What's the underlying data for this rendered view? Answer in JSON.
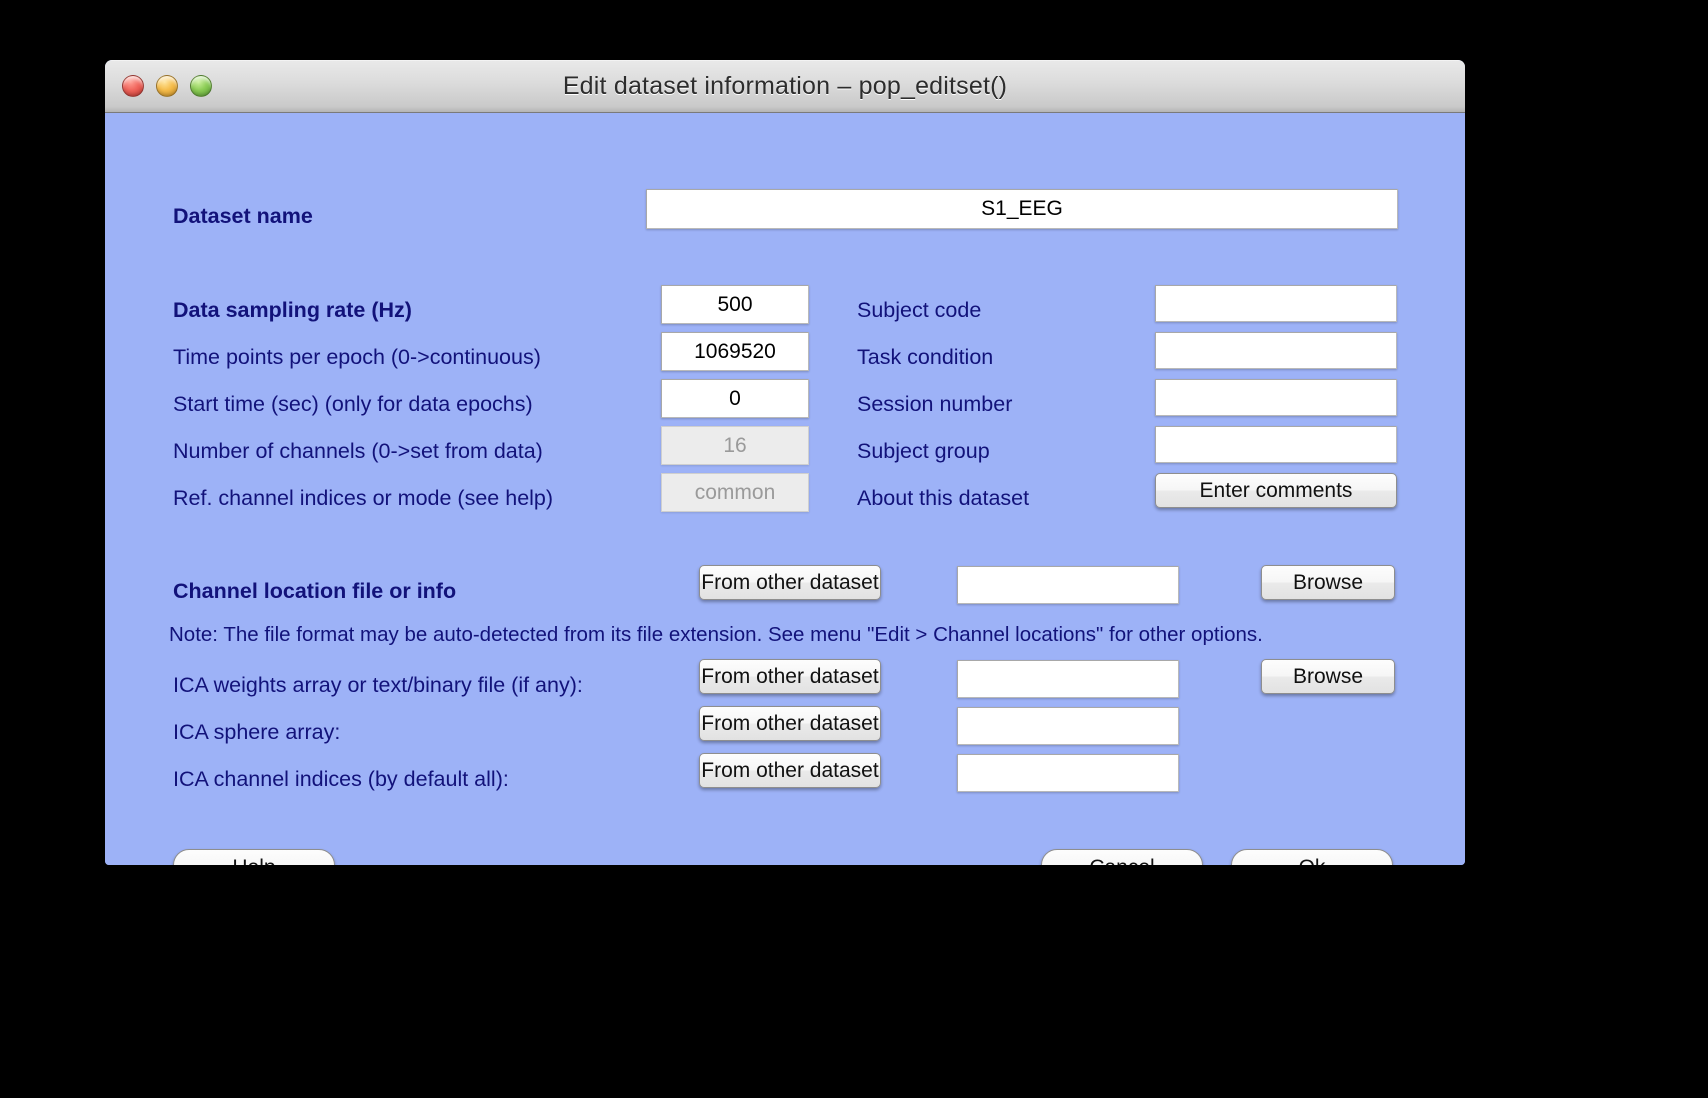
{
  "window": {
    "title": "Edit dataset information – pop_editset()",
    "controls": {
      "close": "close-button",
      "minimize": "minimize-button",
      "zoom": "zoom-button"
    },
    "background_color": "#9db2f7",
    "label_color": "#12127a"
  },
  "dataset_name": {
    "label": "Dataset name",
    "value": "S1_EEG",
    "placeholder": ""
  },
  "left_column": [
    {
      "label": "Data sampling rate (Hz)",
      "bold": true,
      "value": "500",
      "disabled": false
    },
    {
      "label": "Time points per epoch (0->continuous)",
      "bold": false,
      "value": "1069520",
      "disabled": false
    },
    {
      "label": "Start time (sec) (only for data epochs)",
      "bold": false,
      "value": "0",
      "disabled": false
    },
    {
      "label": "Number of channels (0->set from data)",
      "bold": false,
      "value": "16",
      "disabled": true
    },
    {
      "label": "Ref. channel indices or mode (see help)",
      "bold": false,
      "value": "common",
      "disabled": true
    }
  ],
  "right_column": [
    {
      "label": "Subject code",
      "value": ""
    },
    {
      "label": "Task condition",
      "value": ""
    },
    {
      "label": "Session number",
      "value": ""
    },
    {
      "label": "Subject group",
      "value": ""
    }
  ],
  "about": {
    "label": "About this dataset",
    "button_label": "Enter comments"
  },
  "channel_section": {
    "label": "Channel location file or info",
    "from_other_dataset_label": "From other dataset",
    "value": "",
    "browse_label": "Browse",
    "note": " Note: The file format may be auto-detected from its file extension. See menu \"Edit > Channel locations\" for other options."
  },
  "ica_rows": [
    {
      "label": "ICA weights array or text/binary file (if any):",
      "from_other_dataset_label": "From other dataset",
      "value": "",
      "browse_label": "Browse",
      "has_browse": true
    },
    {
      "label": "ICA sphere array:",
      "from_other_dataset_label": "From other dataset",
      "value": "",
      "browse_label": "",
      "has_browse": false
    },
    {
      "label": "ICA channel indices (by default all):",
      "from_other_dataset_label": "From other dataset",
      "value": "",
      "browse_label": "",
      "has_browse": false
    }
  ],
  "footer": {
    "help_label": "Help",
    "cancel_label": "Cancel",
    "ok_label": "Ok"
  }
}
